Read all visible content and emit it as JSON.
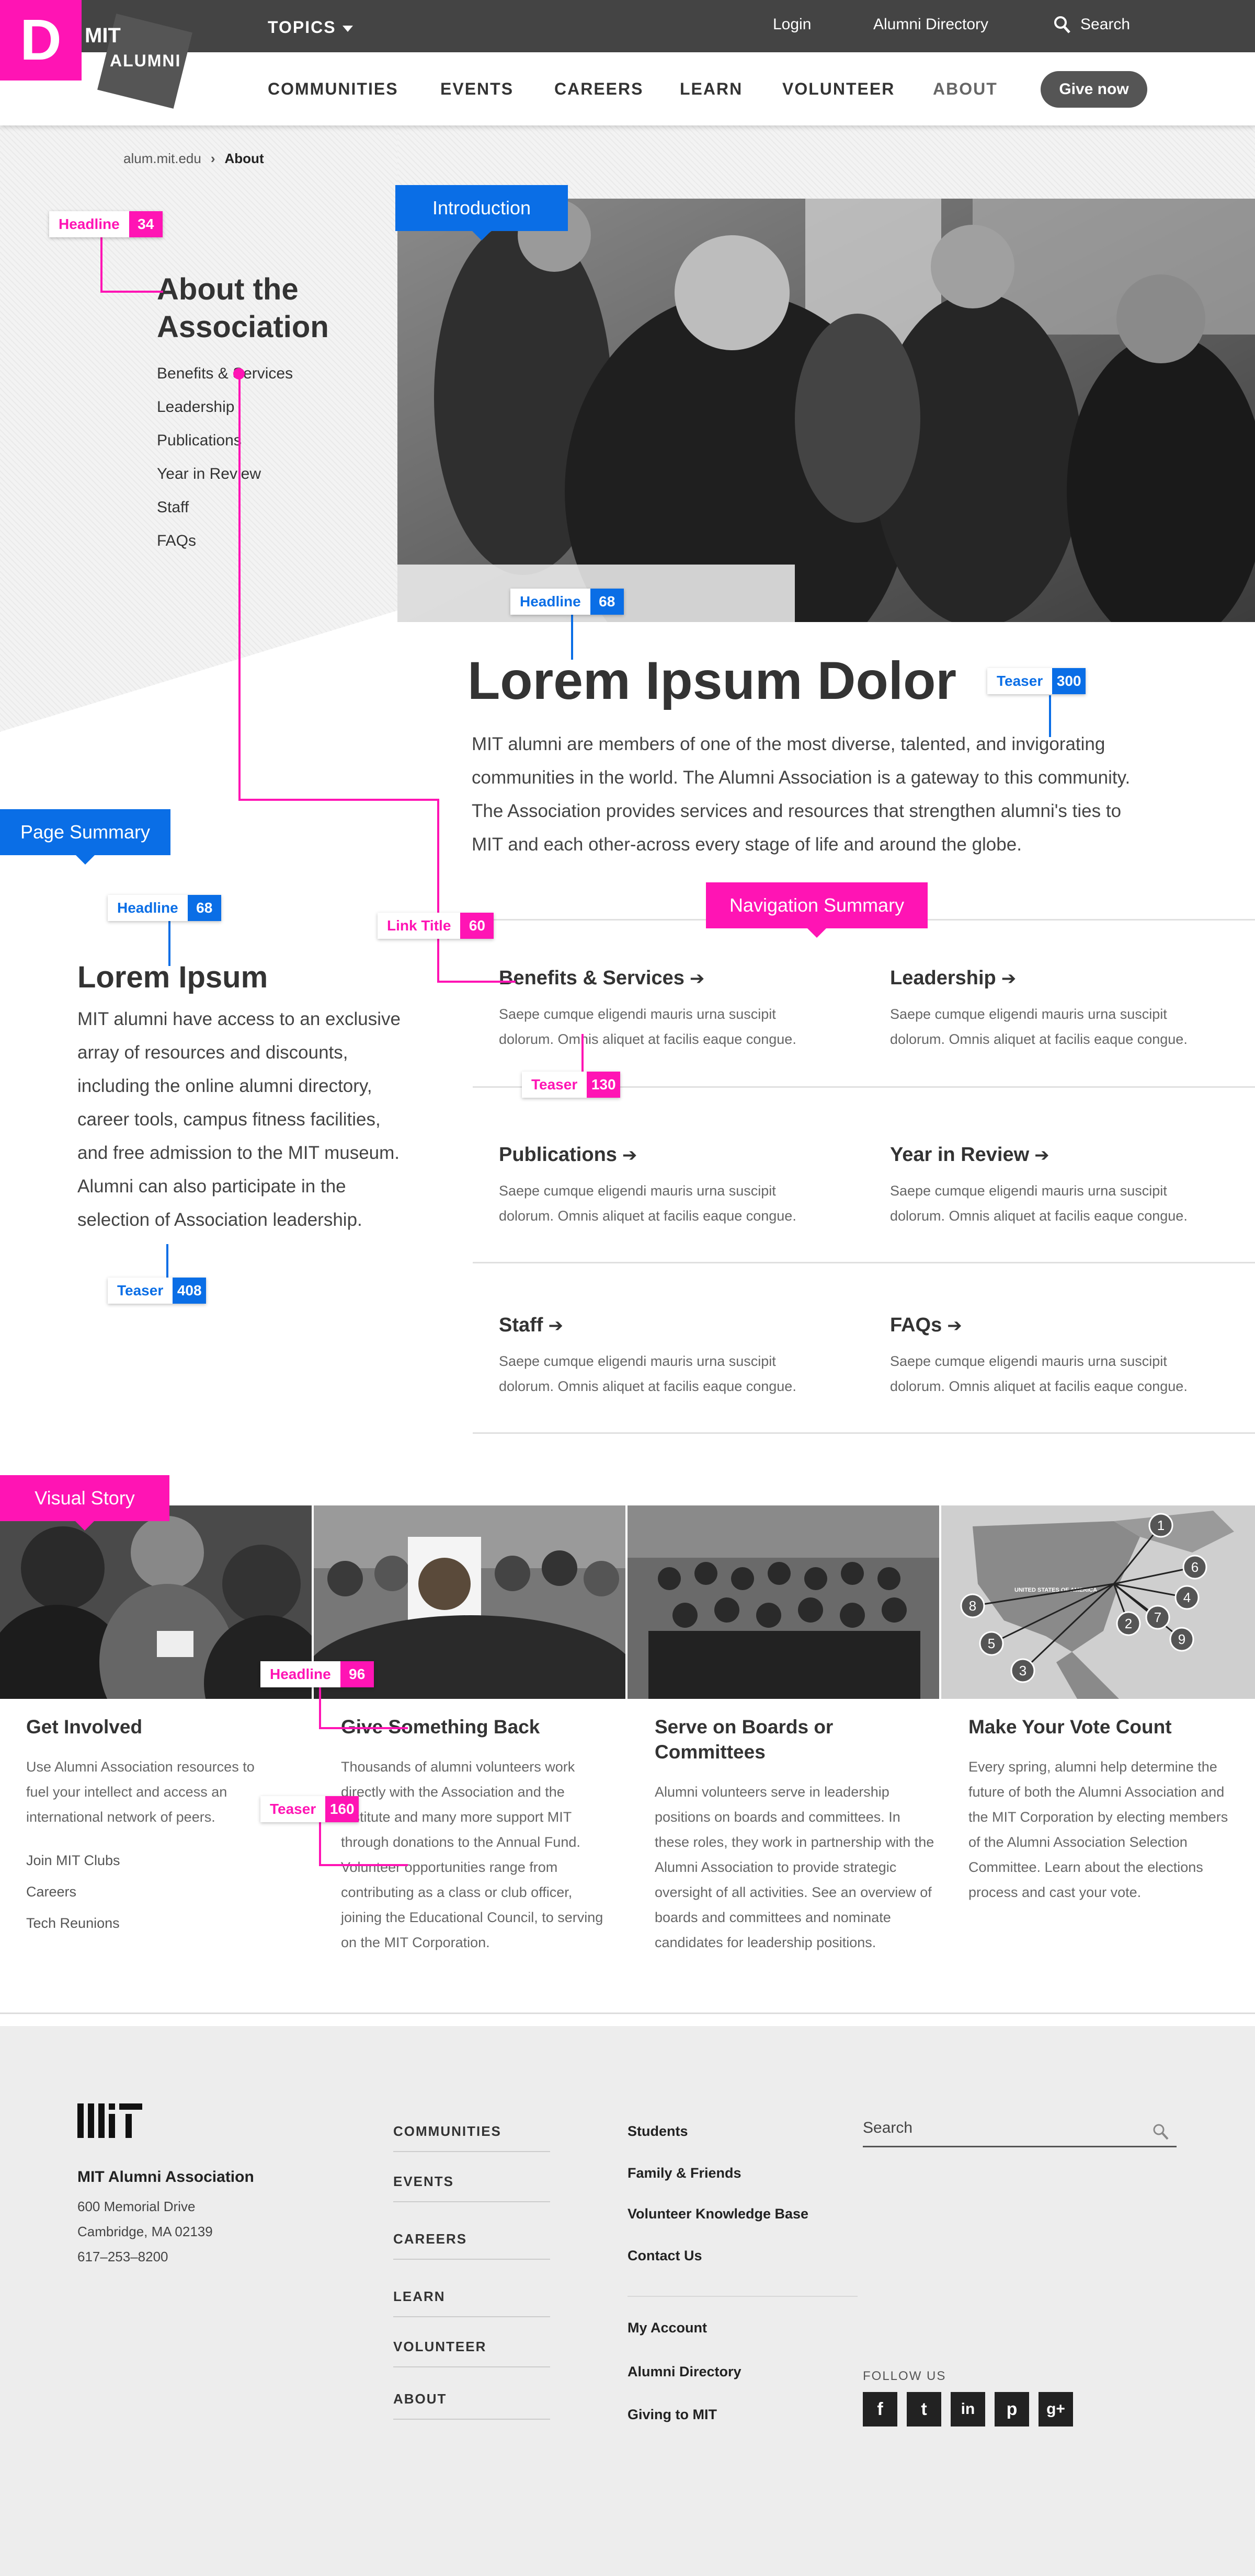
{
  "colors": {
    "annotation_pink": "#ff14b4",
    "annotation_blue": "#0a6ee6",
    "topbar": "#444444",
    "button": "#555555"
  },
  "badge": "D",
  "logo": {
    "line1": "MIT",
    "line2": "ALUMNI"
  },
  "topbar": {
    "topics": "TOPICS",
    "login": "Login",
    "directory": "Alumni Directory",
    "search": "Search"
  },
  "nav": {
    "items": [
      "COMMUNITIES",
      "EVENTS",
      "CAREERS",
      "LEARN",
      "VOLUNTEER",
      "ABOUT"
    ],
    "give": "Give now"
  },
  "breadcrumb": {
    "home": "alum.mit.edu",
    "current": "About"
  },
  "sidebar": {
    "title": "About the Association",
    "links": [
      "Benefits & Services",
      "Leadership",
      "Publications",
      "Year in Review",
      "Staff",
      "FAQs"
    ]
  },
  "intro": {
    "title": "Lorem Ipsum Dolor",
    "text": "MIT alumni are members of one of the most diverse, talented, and invigorating communities in the world. The Alumni Association is a gateway to this community. The Association provides services and resources that strengthen alumni's ties to MIT and each other-across every stage of life and around the globe."
  },
  "summary": {
    "title": "Lorem Ipsum",
    "text": "MIT alumni have access to an exclusive array of resources and discounts, including the online alumni directory, career tools, campus fitness facilities, and free admission to the MIT museum. Alumni can also participate in the selection of Association leadership."
  },
  "nav_summary": {
    "items": [
      {
        "title": "Benefits & Services",
        "text": "Saepe cumque eligendi mauris urna suscipit dolorum. Omnis aliquet at facilis eaque congue."
      },
      {
        "title": "Leadership",
        "text": "Saepe cumque eligendi mauris urna suscipit dolorum. Omnis aliquet at facilis eaque congue."
      },
      {
        "title": "Publications",
        "text": "Saepe cumque eligendi mauris urna suscipit dolorum. Omnis aliquet at facilis eaque congue."
      },
      {
        "title": "Year in Review",
        "text": "Saepe cumque eligendi mauris urna suscipit dolorum. Omnis aliquet at facilis eaque congue."
      },
      {
        "title": "Staff",
        "text": "Saepe cumque eligendi mauris urna suscipit dolorum. Omnis aliquet at facilis eaque congue."
      },
      {
        "title": "FAQs",
        "text": "Saepe cumque eligendi mauris urna suscipit dolorum. Omnis aliquet at facilis eaque congue."
      }
    ],
    "arrow": "➔"
  },
  "visual_story": {
    "cards": [
      {
        "title": "Get Involved",
        "text": "Use Alumni Association resources to fuel your intellect and access an international network of peers.",
        "links": [
          "Join MIT Clubs",
          "Careers",
          "Tech Reunions"
        ]
      },
      {
        "title": "Give Something Back",
        "text": "Thousands of alumni volunteers work directly with the Association and the Institute and many more support MIT through donations to the Annual Fund. Volunteer opportunities range from contributing as a class or club officer, joining the Educational Council, to serving on the MIT Corporation."
      },
      {
        "title": "Serve on Boards or Committees",
        "text": "Alumni volunteers serve in leadership positions on boards and committees. In these roles, they work in partnership with the Alumni Association to provide strategic oversight of all activities. See an overview of boards and committees and nominate candidates for leadership positions."
      },
      {
        "title": "Make Your Vote Count",
        "text": "Every spring, alumni help determine the future of both the Alumni Association and the MIT Corporation by electing members of the Alumni Association Selection Committee. Learn about the elections process and cast your vote."
      }
    ],
    "map_label": "UNITED STATES OF AMERICA",
    "map_pins": [
      "1",
      "6",
      "4",
      "7",
      "9",
      "2",
      "3",
      "5",
      "8"
    ]
  },
  "footer": {
    "org": "MIT Alumni Association",
    "address": [
      "600 Memorial Drive",
      "Cambridge, MA 02139",
      "617–253–8200"
    ],
    "nav": [
      "COMMUNITIES",
      "EVENTS",
      "CAREERS",
      "LEARN",
      "VOLUNTEER",
      "ABOUT"
    ],
    "links_a": [
      "Students",
      "Family & Friends",
      "Volunteer Knowledge Base",
      "Contact Us"
    ],
    "links_b": [
      "My Account",
      "Alumni Directory",
      "Giving to MIT"
    ],
    "search_placeholder": "Search",
    "follow": "FOLLOW US",
    "social": [
      "f",
      "t",
      "in",
      "p",
      "g+"
    ]
  },
  "annotations": {
    "introduction": "Introduction",
    "page_summary": "Page Summary",
    "navigation_summary": "Navigation Summary",
    "visual_story": "Visual Story",
    "labels": [
      {
        "text": "Headline",
        "count": "34"
      },
      {
        "text": "Headline",
        "count": "68"
      },
      {
        "text": "Teaser",
        "count": "300"
      },
      {
        "text": "Headline",
        "count": "68"
      },
      {
        "text": "Link Title",
        "count": "60"
      },
      {
        "text": "Teaser",
        "count": "130"
      },
      {
        "text": "Teaser",
        "count": "408"
      },
      {
        "text": "Headline",
        "count": "96"
      },
      {
        "text": "Teaser",
        "count": "160"
      }
    ]
  }
}
